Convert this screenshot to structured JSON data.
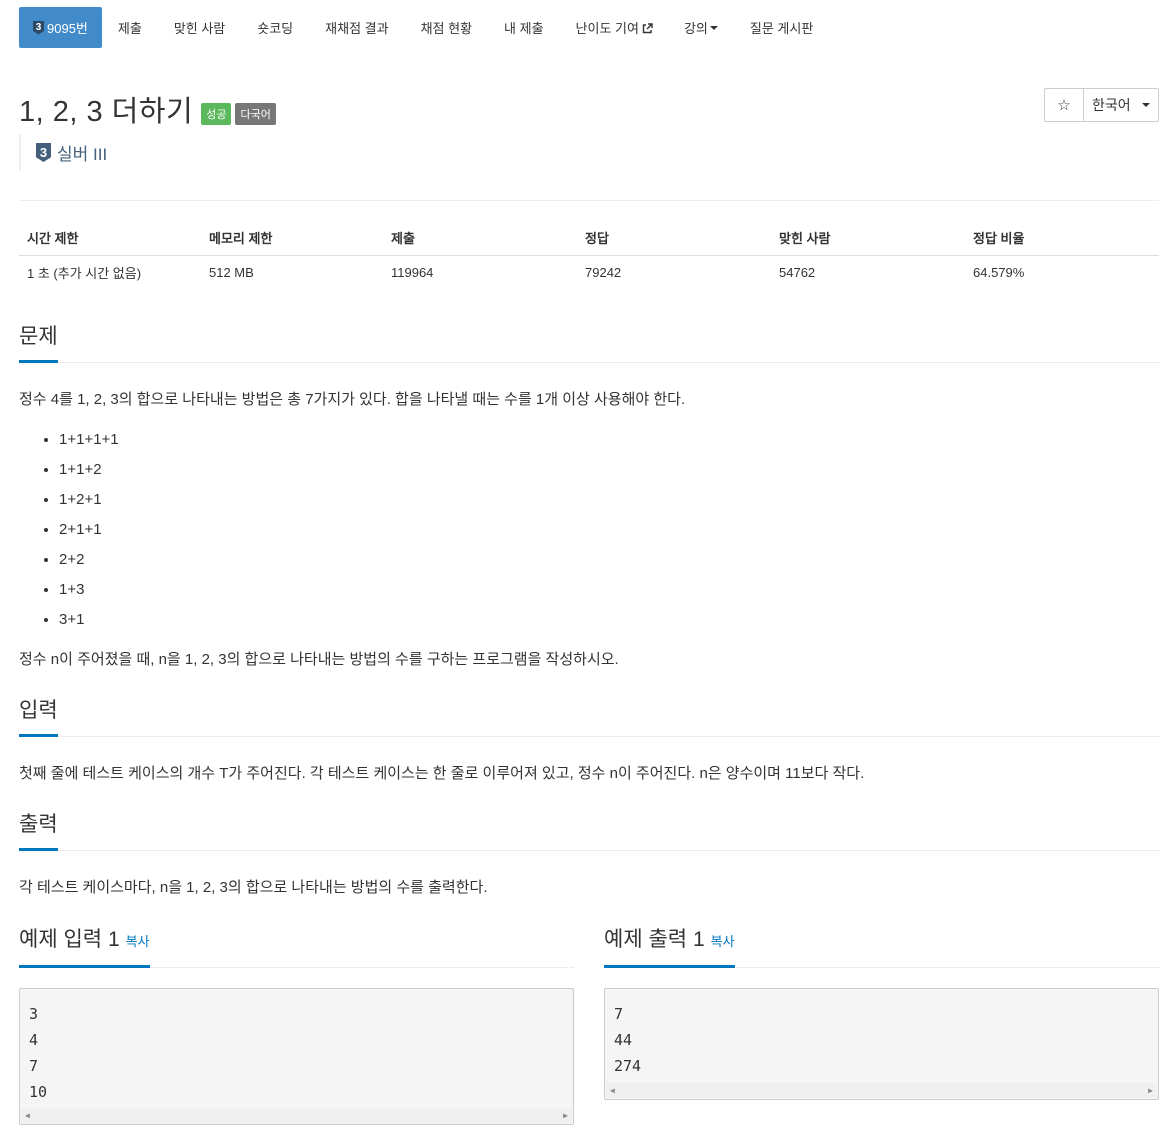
{
  "nav": {
    "problem_tier": "3",
    "problem_id": "9095번",
    "items": [
      {
        "label": "제출"
      },
      {
        "label": "맞힌 사람"
      },
      {
        "label": "숏코딩"
      },
      {
        "label": "재채점 결과"
      },
      {
        "label": "채점 현황"
      },
      {
        "label": "내 제출"
      },
      {
        "label": "난이도 기여"
      },
      {
        "label": "강의"
      },
      {
        "label": "질문 게시판"
      }
    ]
  },
  "header": {
    "title": "1, 2, 3 더하기",
    "success_label": "성공",
    "multilang_label": "다국어",
    "tier_number": "3",
    "tier_text": "실버 III",
    "star_icon": "☆",
    "language_select": "한국어"
  },
  "info_table": {
    "headers": [
      "시간 제한",
      "메모리 제한",
      "제출",
      "정답",
      "맞힌 사람",
      "정답 비율"
    ],
    "values": [
      "1 초 (추가 시간 없음)",
      "512 MB",
      "119964",
      "79242",
      "54762",
      "64.579%"
    ]
  },
  "problem": {
    "heading": "문제",
    "intro": "정수 4를 1, 2, 3의 합으로 나타내는 방법은 총 7가지가 있다. 합을 나타낼 때는 수를 1개 이상 사용해야 한다.",
    "items": [
      "1+1+1+1",
      "1+1+2",
      "1+2+1",
      "2+1+1",
      "2+2",
      "1+3",
      "3+1"
    ],
    "outro": "정수 n이 주어졌을 때, n을 1, 2, 3의 합으로 나타내는 방법의 수를 구하는 프로그램을 작성하시오."
  },
  "input": {
    "heading": "입력",
    "text": "첫째 줄에 테스트 케이스의 개수 T가 주어진다. 각 테스트 케이스는 한 줄로 이루어져 있고, 정수 n이 주어진다. n은 양수이며 11보다 작다."
  },
  "output": {
    "heading": "출력",
    "text": "각 테스트 케이스마다, n을 1, 2, 3의 합으로 나타내는 방법의 수를 출력한다."
  },
  "sample_input": {
    "heading": "예제 입력 1",
    "copy_label": "복사",
    "lines": [
      "3",
      "4",
      "7",
      "10"
    ]
  },
  "sample_output": {
    "heading": "예제 출력 1",
    "copy_label": "복사",
    "lines": [
      "7",
      "44",
      "274"
    ]
  },
  "colors": {
    "primary": "#428bca",
    "section_underline": "#0076c0",
    "success": "#5cb85c",
    "tier_silver": "#435f7a"
  }
}
